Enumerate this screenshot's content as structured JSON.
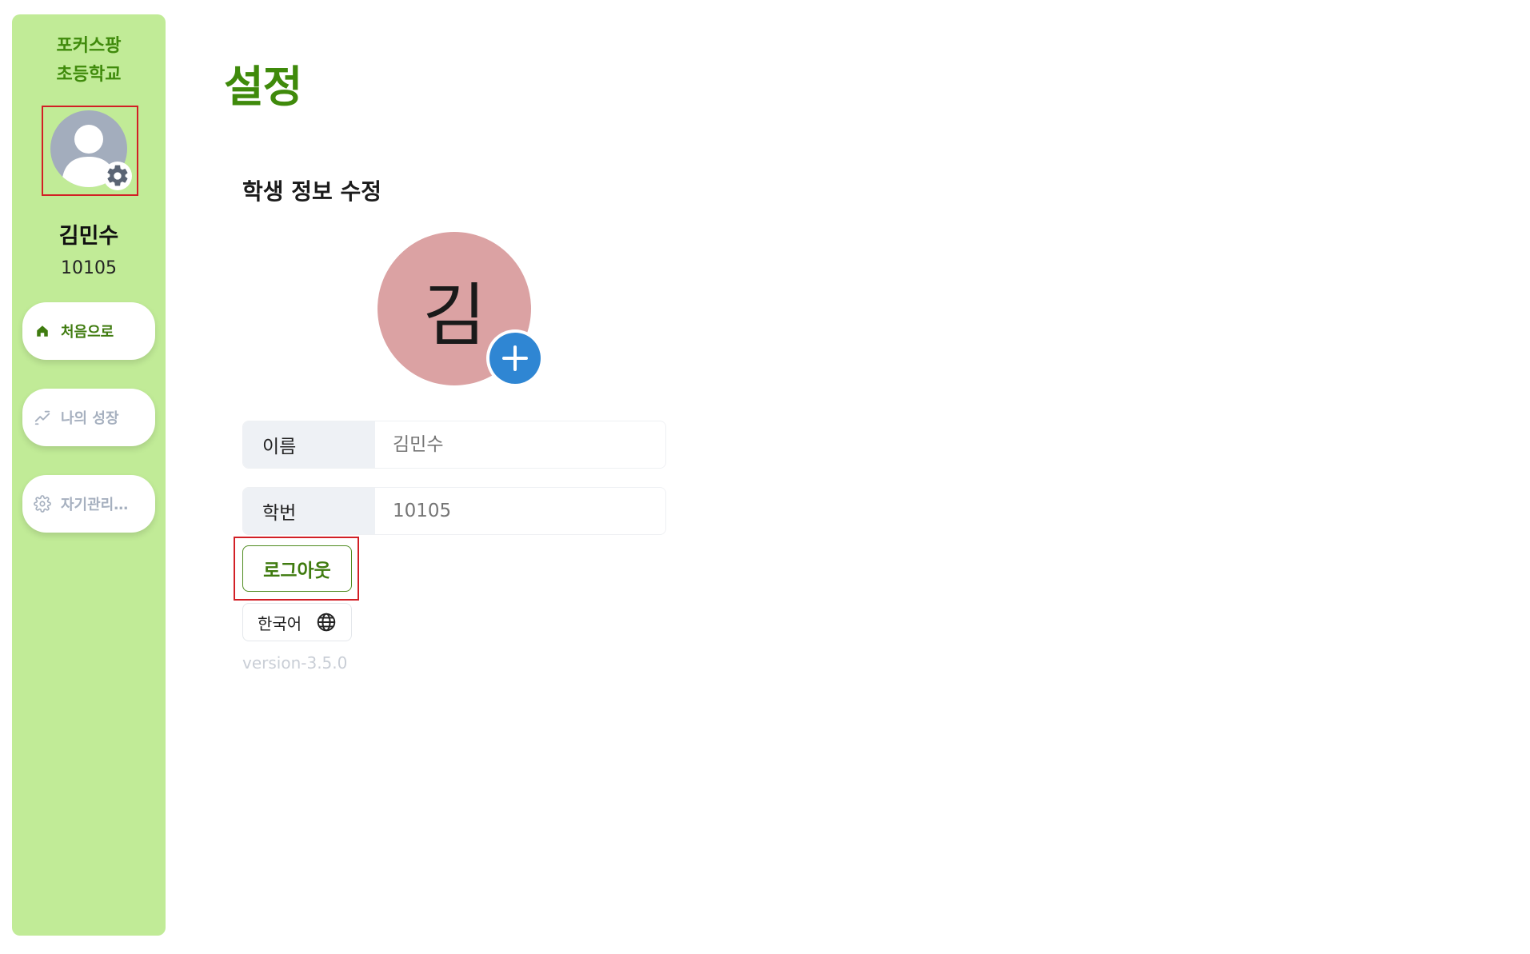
{
  "sidebar": {
    "school_name": "포커스팡\n초등학교",
    "student_name": "김민수",
    "student_number": "10105",
    "nav": [
      {
        "label": "처음으로",
        "icon": "home-icon",
        "active": true
      },
      {
        "label": "나의 성장",
        "icon": "growth-chart-icon",
        "active": false
      },
      {
        "label": "자기관리…",
        "icon": "gear-icon",
        "active": false
      }
    ]
  },
  "main": {
    "title": "설정",
    "section_title": "학생 정보 수정",
    "profile_initial": "김",
    "fields": {
      "name_label": "이름",
      "name_placeholder": "김민수",
      "number_label": "학번",
      "number_placeholder": "10105"
    },
    "logout_label": "로그아웃",
    "language_label": "한국어",
    "version": "version-3.5.0"
  },
  "colors": {
    "sidebar_bg": "#c1eb97",
    "brand_green": "#3f8a0b",
    "avatar_gray": "#a3adbd",
    "profile_pink": "#dba2a3",
    "add_blue": "#2f86d3",
    "highlight_red": "#d21f25"
  }
}
